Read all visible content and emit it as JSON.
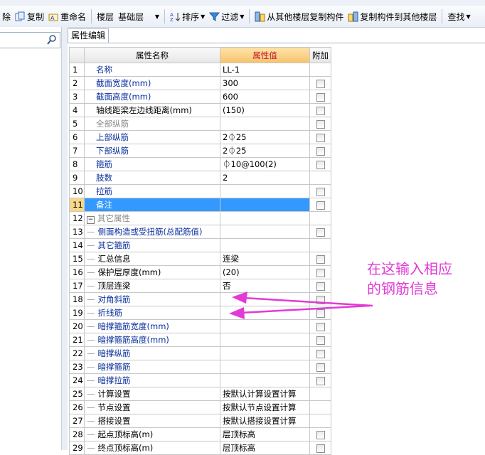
{
  "toolbar": {
    "delete": "除",
    "copy": "复制",
    "rename": "重命名",
    "floor_label": "楼层",
    "floor_value": "基础层",
    "sort": "排序",
    "filter": "过滤",
    "copy_from_other": "从其他楼层复制构件",
    "copy_to_other": "复制构件到其他楼层",
    "find": "查找"
  },
  "tab": {
    "label": "属性编辑"
  },
  "grid": {
    "headers": {
      "name": "属性名称",
      "value": "属性值",
      "attach": "附加"
    },
    "rows": [
      {
        "idx": "1",
        "name": "名称",
        "value": "LL-1",
        "color": "blue",
        "indent": false,
        "checkbox": false
      },
      {
        "idx": "2",
        "name": "截面宽度(mm)",
        "value": "300",
        "color": "blue",
        "indent": false,
        "checkbox": true
      },
      {
        "idx": "3",
        "name": "截面高度(mm)",
        "value": "600",
        "color": "blue",
        "indent": false,
        "checkbox": true
      },
      {
        "idx": "4",
        "name": "轴线距梁左边线距离(mm)",
        "value": "(150)",
        "color": "black",
        "indent": false,
        "checkbox": true
      },
      {
        "idx": "5",
        "name": "全部纵筋",
        "value": "",
        "color": "gray",
        "indent": false,
        "checkbox": true
      },
      {
        "idx": "6",
        "name": "上部纵筋",
        "value": "2⏀25",
        "color": "blue",
        "indent": false,
        "checkbox": true
      },
      {
        "idx": "7",
        "name": "下部纵筋",
        "value": "2⏀25",
        "color": "blue",
        "indent": false,
        "checkbox": true
      },
      {
        "idx": "8",
        "name": "箍筋",
        "value": "⏀10@100(2)",
        "color": "blue",
        "indent": false,
        "checkbox": true
      },
      {
        "idx": "9",
        "name": "肢数",
        "value": "2",
        "color": "blue",
        "indent": false,
        "checkbox": false
      },
      {
        "idx": "10",
        "name": "拉筋",
        "value": "",
        "color": "blue",
        "indent": false,
        "checkbox": true
      },
      {
        "idx": "11",
        "name": "备注",
        "value": "",
        "color": "blue",
        "indent": false,
        "checkbox": true,
        "selected": true
      },
      {
        "idx": "12",
        "name": "其它属性",
        "value": "",
        "color": "gray",
        "indent": false,
        "checkbox": false,
        "group": true
      },
      {
        "idx": "13",
        "name": "侧面构造或受扭筋(总配筋值)",
        "value": "",
        "color": "blue",
        "indent": true,
        "checkbox": true
      },
      {
        "idx": "14",
        "name": "其它箍筋",
        "value": "",
        "color": "blue",
        "indent": true,
        "checkbox": false
      },
      {
        "idx": "15",
        "name": "汇总信息",
        "value": "连梁",
        "color": "black",
        "indent": true,
        "checkbox": true
      },
      {
        "idx": "16",
        "name": "保护层厚度(mm)",
        "value": "(20)",
        "color": "black",
        "indent": true,
        "checkbox": true
      },
      {
        "idx": "17",
        "name": "顶层连梁",
        "value": "否",
        "color": "black",
        "indent": true,
        "checkbox": true
      },
      {
        "idx": "18",
        "name": "对角斜筋",
        "value": "",
        "color": "blue",
        "indent": true,
        "checkbox": true
      },
      {
        "idx": "19",
        "name": "折线筋",
        "value": "",
        "color": "blue",
        "indent": true,
        "checkbox": true
      },
      {
        "idx": "20",
        "name": "暗撑箍筋宽度(mm)",
        "value": "",
        "color": "blue",
        "indent": true,
        "checkbox": true
      },
      {
        "idx": "21",
        "name": "暗撑箍筋高度(mm)",
        "value": "",
        "color": "blue",
        "indent": true,
        "checkbox": true
      },
      {
        "idx": "22",
        "name": "暗撑纵筋",
        "value": "",
        "color": "blue",
        "indent": true,
        "checkbox": true
      },
      {
        "idx": "23",
        "name": "暗撑箍筋",
        "value": "",
        "color": "blue",
        "indent": true,
        "checkbox": true
      },
      {
        "idx": "24",
        "name": "暗撑拉筋",
        "value": "",
        "color": "blue",
        "indent": true,
        "checkbox": true
      },
      {
        "idx": "25",
        "name": "计算设置",
        "value": "按默认计算设置计算",
        "color": "black",
        "indent": true,
        "checkbox": false
      },
      {
        "idx": "26",
        "name": "节点设置",
        "value": "按默认节点设置计算",
        "color": "black",
        "indent": true,
        "checkbox": false
      },
      {
        "idx": "27",
        "name": "搭接设置",
        "value": "按默认搭接设置计算",
        "color": "black",
        "indent": true,
        "checkbox": false
      },
      {
        "idx": "28",
        "name": "起点顶标高(m)",
        "value": "层顶标高",
        "color": "black",
        "indent": true,
        "checkbox": true
      },
      {
        "idx": "29",
        "name": "终点顶标高(m)",
        "value": "层顶标高",
        "color": "black",
        "indent": true,
        "checkbox": true
      }
    ]
  },
  "annotation": {
    "line1": "在这输入相应",
    "line2": "的钢筋信息",
    "color": "#e23ad6"
  },
  "colors": {
    "selected_row": "#3399ff",
    "value_header": "#f5c36a",
    "label_blue": "#0a2f9c"
  }
}
